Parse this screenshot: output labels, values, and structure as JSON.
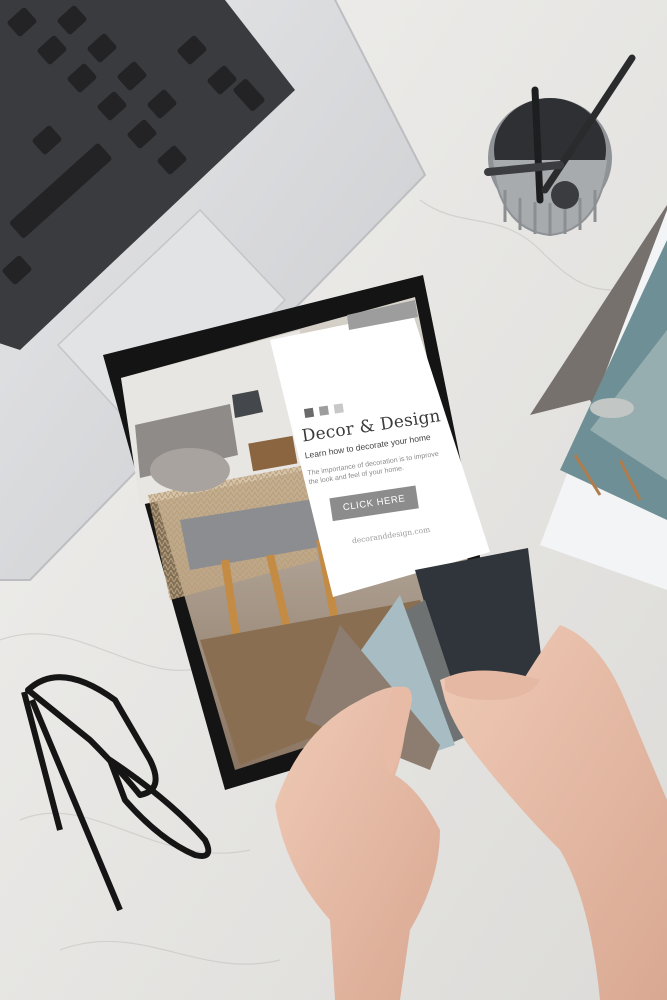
{
  "ad": {
    "title": "Decor & Design",
    "subtitle": "Learn how to decorate your home",
    "body": "The importance of decoration is to improve the look and feel of your home.",
    "cta_label": "CLICK HERE",
    "url": "decoranddesign.com",
    "swatch_colors": [
      "#6a6a6a",
      "#9d9d9d",
      "#c8c8c8"
    ]
  },
  "colors": {
    "marble": "#e9e8e6",
    "laptop": "#d9dadc",
    "keys": "#2b2b2d",
    "tablet_bezel": "#141414",
    "cta": "#8c8c8c",
    "fabric_dark": "#2f353b",
    "fabric_slate": "#6f7273",
    "fabric_blue": "#a8bcc3",
    "fabric_taupe": "#8d7d70",
    "skin": "#e9c1ad"
  }
}
